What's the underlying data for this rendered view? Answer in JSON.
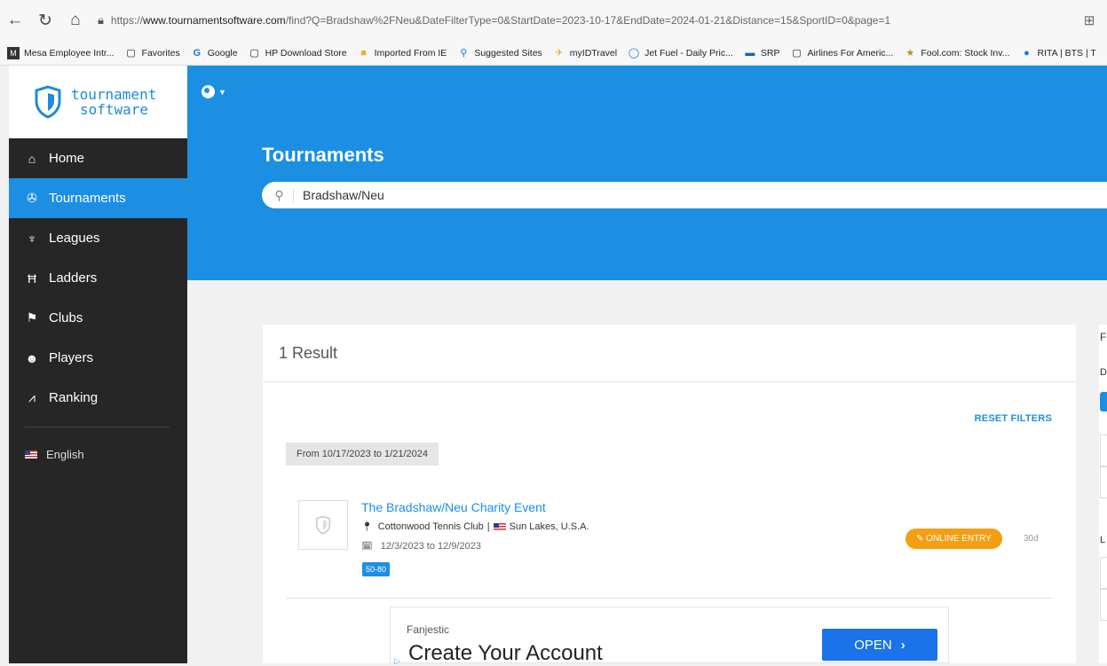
{
  "browser": {
    "url_prefix": "https://",
    "url_domain": "www.tournamentsoftware.com",
    "url_path": "/find?Q=Bradshaw%2FNeu&DateFilterType=0&StartDate=2023-10-17&EndDate=2024-01-21&Distance=15&SportID=0&page=1",
    "favorites": [
      {
        "label": "Mesa Employee Intr...",
        "icon": "M"
      },
      {
        "label": "Favorites",
        "icon": "▢"
      },
      {
        "label": "Google",
        "icon": "G"
      },
      {
        "label": "HP Download Store",
        "icon": "▢"
      },
      {
        "label": "Imported From IE",
        "icon": "■"
      },
      {
        "label": "Suggested Sites",
        "icon": "⚲"
      },
      {
        "label": "myIDTravel",
        "icon": "✈"
      },
      {
        "label": "Jet Fuel - Daily Pric...",
        "icon": "◯"
      },
      {
        "label": "SRP",
        "icon": "▬"
      },
      {
        "label": "Airlines For Americ...",
        "icon": "▢"
      },
      {
        "label": "Fool.com: Stock Inv...",
        "icon": "★"
      },
      {
        "label": "RITA | BTS | T",
        "icon": "●"
      }
    ]
  },
  "brand": {
    "line1": "tournament",
    "line2": "software"
  },
  "sidebar": {
    "items": [
      {
        "label": "Home",
        "icon": "⌂"
      },
      {
        "label": "Tournaments",
        "icon": "✇"
      },
      {
        "label": "Leagues",
        "icon": "♆"
      },
      {
        "label": "Ladders",
        "icon": "Ħ"
      },
      {
        "label": "Clubs",
        "icon": "⚑"
      },
      {
        "label": "Players",
        "icon": "☻"
      },
      {
        "label": "Ranking",
        "icon": "⩘"
      }
    ],
    "language": "English"
  },
  "header": {
    "title": "Tournaments",
    "search_value": "Bradshaw/Neu"
  },
  "results": {
    "count_label": "1 Result",
    "reset_label": "RESET FILTERS",
    "date_range": "From 10/17/2023 to 1/21/2024",
    "items": [
      {
        "title": "The Bradshaw/Neu Charity Event",
        "club": "Cottonwood Tennis Club",
        "separator": "|",
        "location": "Sun Lakes, U.S.A.",
        "dates": "12/3/2023 to 12/9/2023",
        "badge": "50-80",
        "entry_label": "ONLINE ENTRY",
        "days": "30d"
      }
    ]
  },
  "ad": {
    "advertiser": "Fanjestic",
    "headline": "Create Your Account",
    "cta": "OPEN"
  },
  "right_panel": {
    "f": "F",
    "d": "D",
    "l": "L"
  },
  "colors": {
    "accent": "#1c8fe3",
    "sidebar": "#262626",
    "entry": "#f59e12"
  }
}
